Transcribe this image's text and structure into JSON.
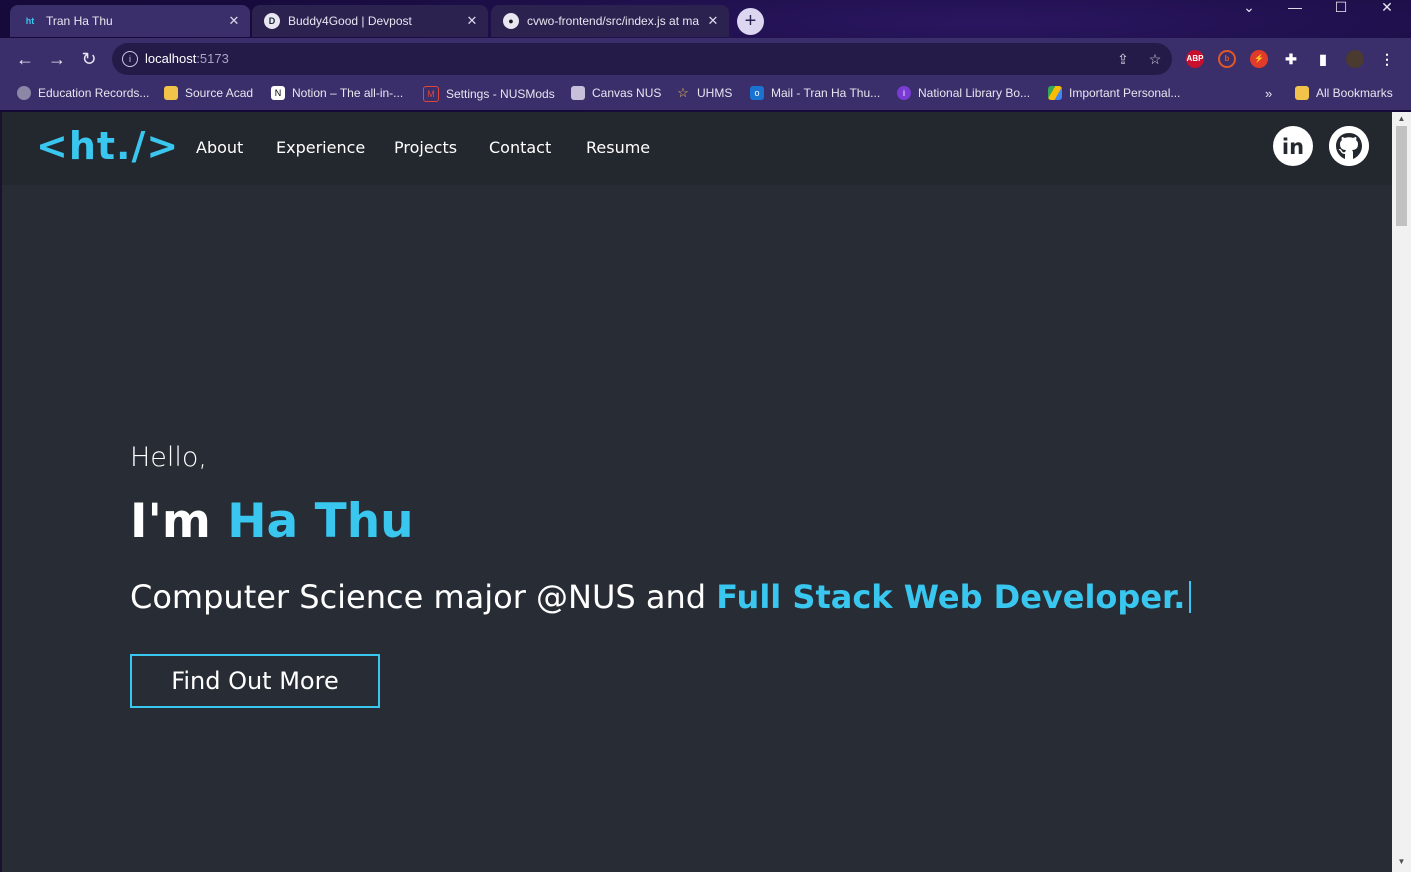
{
  "tabs": [
    {
      "title": "Tran Ha Thu",
      "favicon": "ht"
    },
    {
      "title": "Buddy4Good | Devpost",
      "favicon": "D"
    },
    {
      "title": "cvwo-frontend/src/index.js at ma",
      "favicon": "github-icon"
    }
  ],
  "address": {
    "host": "localhost",
    "port": ":5173"
  },
  "bookmarks": [
    {
      "label": "Education Records...",
      "icon": "globe-icon"
    },
    {
      "label": "Source Acad",
      "icon": "folder-icon"
    },
    {
      "label": "Notion – The all-in-...",
      "icon": "notion-icon"
    },
    {
      "label": "Settings - NUSMods",
      "icon": "nusmods-icon"
    },
    {
      "label": "Canvas NUS",
      "icon": "canvas-icon"
    },
    {
      "label": "UHMS",
      "icon": "star-icon"
    },
    {
      "label": "Mail - Tran Ha Thu...",
      "icon": "outlook-icon"
    },
    {
      "label": "National Library Bo...",
      "icon": "nlb-icon"
    },
    {
      "label": "Important Personal...",
      "icon": "drive-icon"
    }
  ],
  "bookmarks_overflow": "»",
  "all_bookmarks": "All Bookmarks",
  "ext_abp": "ABP",
  "site": {
    "logo": "<ht./>",
    "nav": [
      "About",
      "Experience",
      "Projects",
      "Contact",
      "Resume"
    ],
    "hello": "Hello,",
    "im": "I'm ",
    "name": "Ha Thu",
    "subtitle_plain": "Computer Science major @NUS and ",
    "subtitle_accent": "Full Stack Web Developer.",
    "cta": "Find Out More"
  },
  "colors": {
    "accent": "#39c6ef",
    "page_bg": "#282c34",
    "nav_bg": "#23272e"
  }
}
